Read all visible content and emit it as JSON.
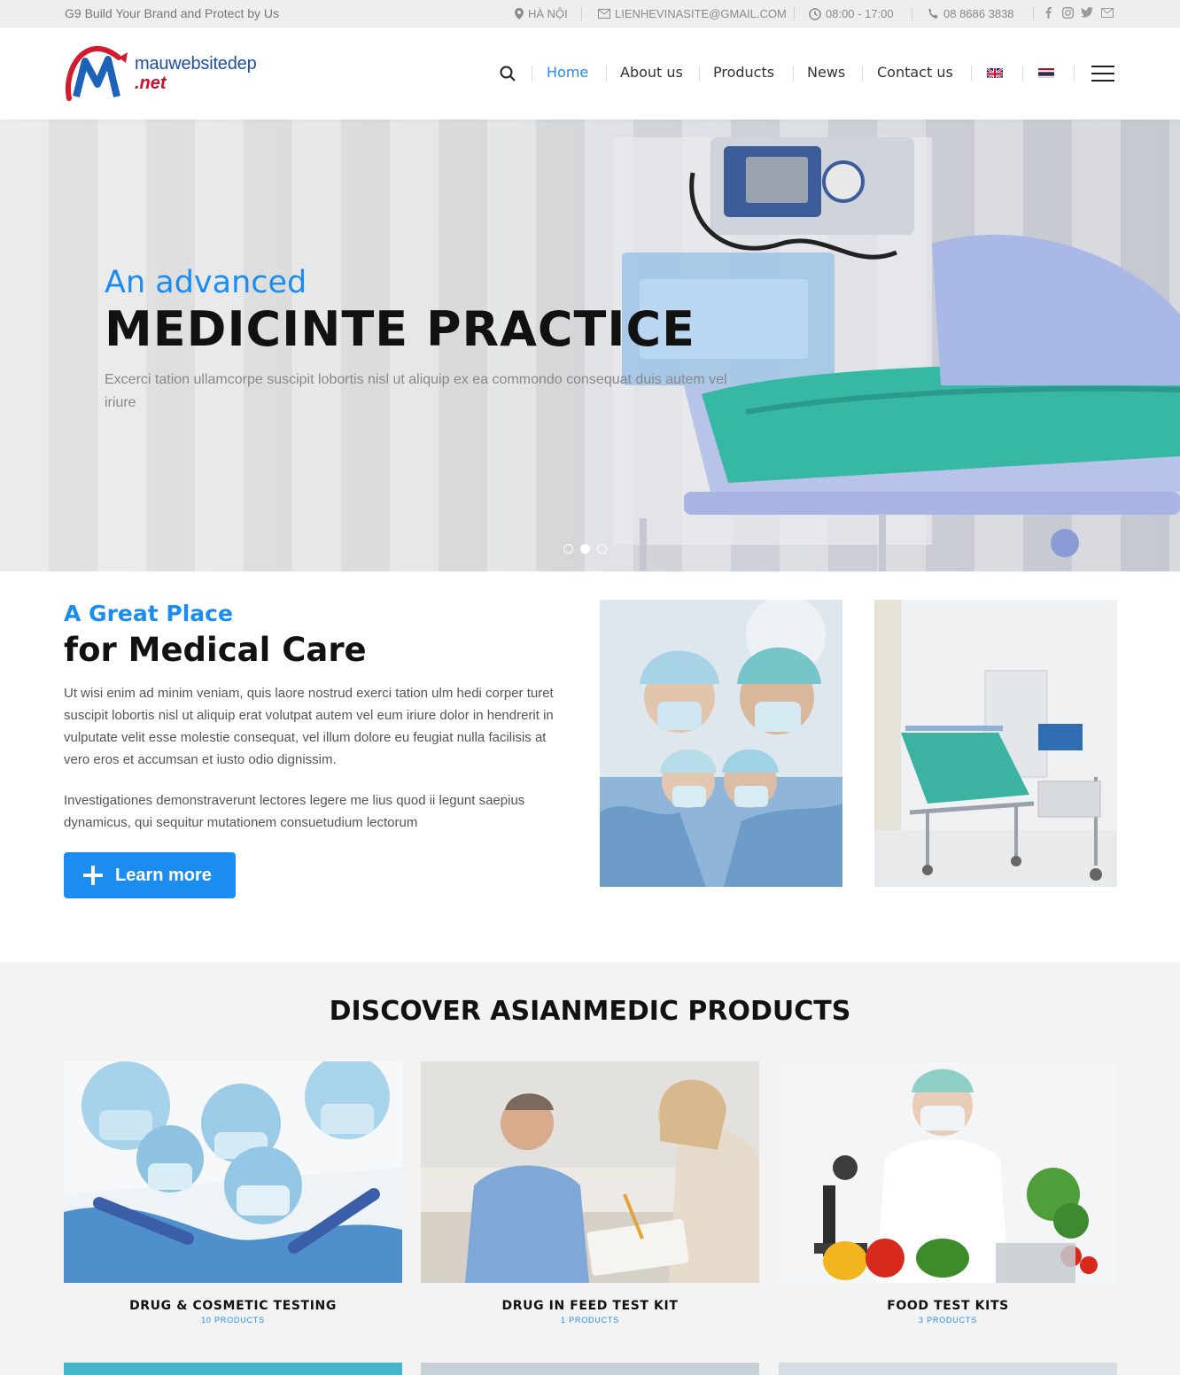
{
  "topbar": {
    "tagline": "G9 Build Your Brand and Protect by Us",
    "location": "HÀ NỘI",
    "email": "LIENHEVINASITE@GMAIL.COM",
    "hours": "08:00 - 17:00",
    "phone": "08 8686 3838",
    "social_icons": [
      "facebook-icon",
      "instagram-icon",
      "twitter-icon",
      "mail-icon"
    ]
  },
  "header": {
    "logo_word": "mauwebsitedep",
    "logo_tld": ".net",
    "nav": {
      "home": "Home",
      "about": "About us",
      "products": "Products",
      "news": "News",
      "contact": "Contact us"
    },
    "languages": [
      "english-flag-icon",
      "thai-flag-icon"
    ]
  },
  "hero": {
    "subtitle": "An advanced",
    "title": "MEDICINTE PRACTICE",
    "description": "Excerci tation ullamcorpe suscipit lobortis nisl ut aliquip ex ea commondo consequat duis autem vel  iriure",
    "active_slide": 2,
    "slide_count": 3
  },
  "about": {
    "subtitle": "A Great Place",
    "title": "for Medical Care",
    "paragraph1": "Ut wisi enim ad minim veniam, quis laore nostrud exerci tation ulm hedi corper turet suscipit lobortis nisl ut aliquip erat volutpat autem vel eum iriure dolor in hendrerit in vulputate velit esse molestie consequat, vel illum dolore eu feugiat nulla facilisis at vero eros et accumsan et iusto odio dignissim.",
    "paragraph2": "Investigationes demonstraverunt lectores legere me lius quod ii legunt saepius dynamicus, qui sequitur mutationem consuetudium lectorum",
    "button": "Learn more"
  },
  "products": {
    "heading": "DISCOVER ASIANMEDIC PRODUCTS",
    "items": [
      {
        "name": "DRUG & COSMETIC TESTING",
        "count": "10 PRODUCTS"
      },
      {
        "name": "DRUG IN FEED TEST KIT",
        "count": "1 PRODUCTS"
      },
      {
        "name": "FOOD TEST KITS",
        "count": "3 PRODUCTS"
      }
    ]
  },
  "colors": {
    "accent": "#1c8df0",
    "dark": "#111111",
    "topbar_bg": "#ededed",
    "products_bg": "#f3f3f3"
  }
}
